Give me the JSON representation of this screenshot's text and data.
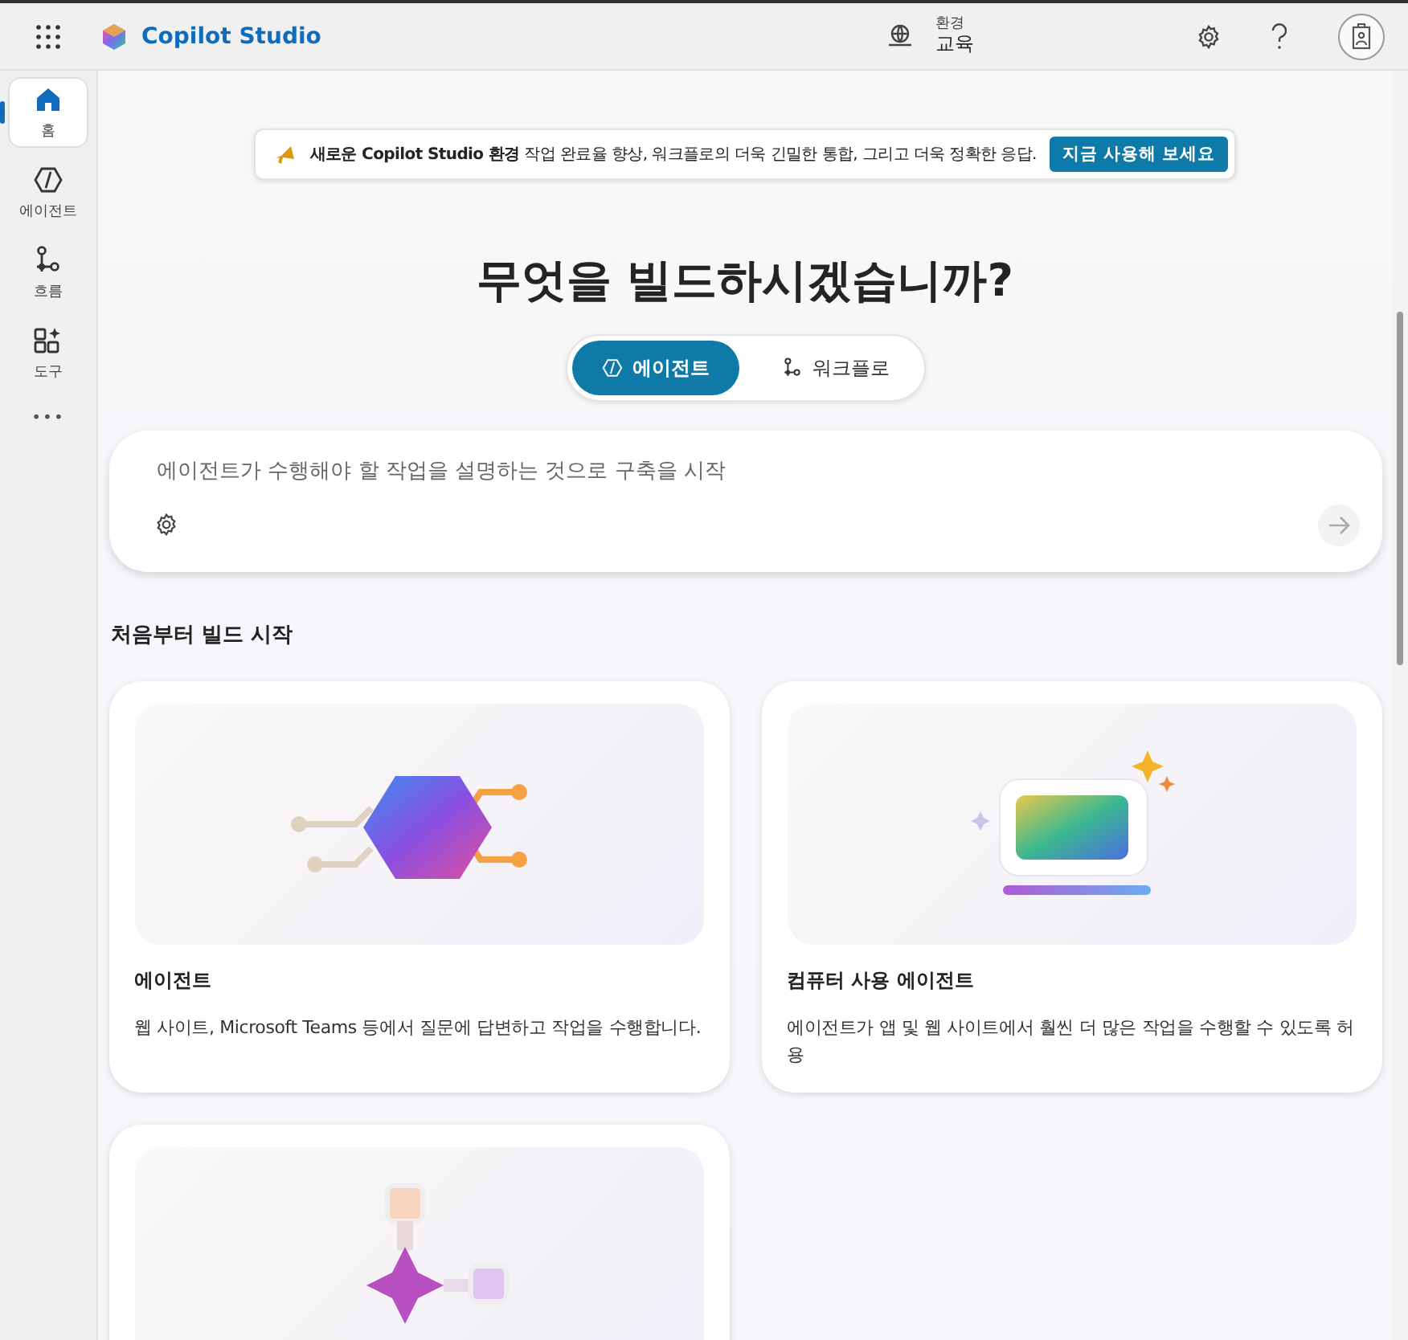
{
  "header": {
    "app_name": "Copilot Studio",
    "environment_label": "환경",
    "environment_name": "교육"
  },
  "sidebar": {
    "items": [
      {
        "label": "홈",
        "selected": true
      },
      {
        "label": "에이전트",
        "selected": false
      },
      {
        "label": "흐름",
        "selected": false
      },
      {
        "label": "도구",
        "selected": false
      }
    ],
    "more": "•••"
  },
  "banner": {
    "text": "**새로운 Copilot Studio 환경** 작업 완료율 향상, 워크플로의 더욱 긴밀한 통합, 그리고 더욱 정확한 응답.",
    "button": "지금 사용해 보세요"
  },
  "heading": "무엇을 빌드하시겠습니까?",
  "tabs": [
    {
      "label": "에이전트",
      "selected": true
    },
    {
      "label": "워크플로",
      "selected": false
    }
  ],
  "prompt": {
    "placeholder": "에이전트가 수행해야 할 작업을 설명하는 것으로 구축을 시작"
  },
  "section_title": "처음부터 빌드 시작",
  "cards": [
    {
      "kind": "agent",
      "title": "에이전트",
      "description": "웹 사이트, Microsoft Teams 등에서 질문에 답변하고 작업을 수행합니다."
    },
    {
      "kind": "computer",
      "title": "컴퓨터 사용 에이전트",
      "description": "에이전트가 앱 및 웹 사이트에서 훨씬 더 많은 작업을 수행할 수 있도록 허용"
    },
    {
      "kind": "flow"
    }
  ]
}
